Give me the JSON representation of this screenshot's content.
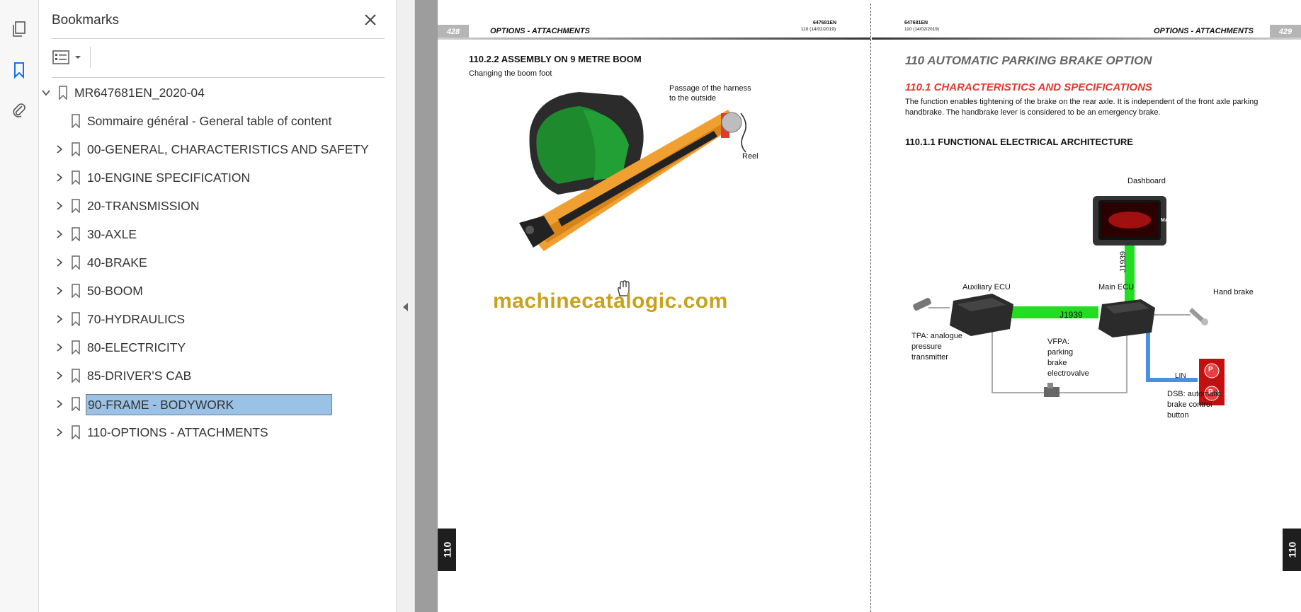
{
  "panel": {
    "title": "Bookmarks",
    "items": [
      {
        "label": "MR647681EN_2020-04",
        "level": 0,
        "expandable": true,
        "expanded": true,
        "selected": false
      },
      {
        "label": "Sommaire général - General table of content",
        "level": 1,
        "expandable": false,
        "expanded": false,
        "selected": false
      },
      {
        "label": "00-GENERAL, CHARACTERISTICS AND SAFETY",
        "level": 1,
        "expandable": true,
        "expanded": false,
        "selected": false
      },
      {
        "label": "10-ENGINE SPECIFICATION",
        "level": 1,
        "expandable": true,
        "expanded": false,
        "selected": false
      },
      {
        "label": "20-TRANSMISSION",
        "level": 1,
        "expandable": true,
        "expanded": false,
        "selected": false
      },
      {
        "label": "30-AXLE",
        "level": 1,
        "expandable": true,
        "expanded": false,
        "selected": false
      },
      {
        "label": "40-BRAKE",
        "level": 1,
        "expandable": true,
        "expanded": false,
        "selected": false
      },
      {
        "label": "50-BOOM",
        "level": 1,
        "expandable": true,
        "expanded": false,
        "selected": false
      },
      {
        "label": "70-HYDRAULICS",
        "level": 1,
        "expandable": true,
        "expanded": false,
        "selected": false
      },
      {
        "label": "80-ELECTRICITY",
        "level": 1,
        "expandable": true,
        "expanded": false,
        "selected": false
      },
      {
        "label": "85-DRIVER'S CAB",
        "level": 1,
        "expandable": true,
        "expanded": false,
        "selected": false
      },
      {
        "label": "90-FRAME - BODYWORK",
        "level": 1,
        "expandable": true,
        "expanded": false,
        "selected": true
      },
      {
        "label": "110-OPTIONS - ATTACHMENTS",
        "level": 1,
        "expandable": true,
        "expanded": false,
        "selected": false
      }
    ]
  },
  "left_page": {
    "page_number": "428",
    "header_title": "OPTIONS - ATTACHMENTS",
    "doc_code": "647681EN",
    "doc_date": "110 (14/02/2019)",
    "section_title": "110.2.2  ASSEMBLY ON 9 METRE BOOM",
    "subtitle": "Changing the boom foot",
    "label_harness": "Passage of the harness",
    "label_harness2": "to the outside",
    "label_reel": "Reel",
    "watermark": "machinecatalogic.com",
    "side_tab": "110"
  },
  "right_page": {
    "page_number": "429",
    "header_title": "OPTIONS - ATTACHMENTS",
    "doc_code": "647681EN",
    "doc_date": "110 (14/02/2019)",
    "chapter_title": "110  AUTOMATIC PARKING BRAKE OPTION",
    "red_heading": "110.1 CHARACTERISTICS AND SPECIFICATIONS",
    "paragraph_line1": "The function enables tightening of the brake on the rear axle. It is independent of the front axle parking",
    "paragraph_line2": "handbrake. The handbrake lever is considered to be an emergency brake.",
    "sub_heading": "110.1.1 FUNCTIONAL ELECTRICAL ARCHITECTURE",
    "diagram": {
      "dashboard": "Dashboard",
      "dashboard_brand": "MANITOU",
      "auxiliary_ecu": "Auxiliary ECU",
      "main_ecu": "Main ECU",
      "hand_brake": "Hand brake",
      "bus_horizontal": "J1939",
      "bus_vertical": "J1939",
      "lin": "LIN",
      "tpa_line1": "TPA: analogue",
      "tpa_line2": "pressure",
      "tpa_line3": "transmitter",
      "vfpa_line1": "VFPA:",
      "vfpa_line2": "parking",
      "vfpa_line3": "brake",
      "vfpa_line4": "electrovalve",
      "dsb_line1": "DSB: automatic",
      "dsb_line2": "brake control",
      "dsb_line3": "button",
      "p_symbol": "P"
    },
    "side_tab": "110"
  },
  "colors": {
    "accent_red": "#e03a2f",
    "bus_green": "#22dd22",
    "lin_blue": "#4a90e2",
    "selection_blue": "#9ac2e6",
    "watermark_gold": "#c7a21b"
  }
}
